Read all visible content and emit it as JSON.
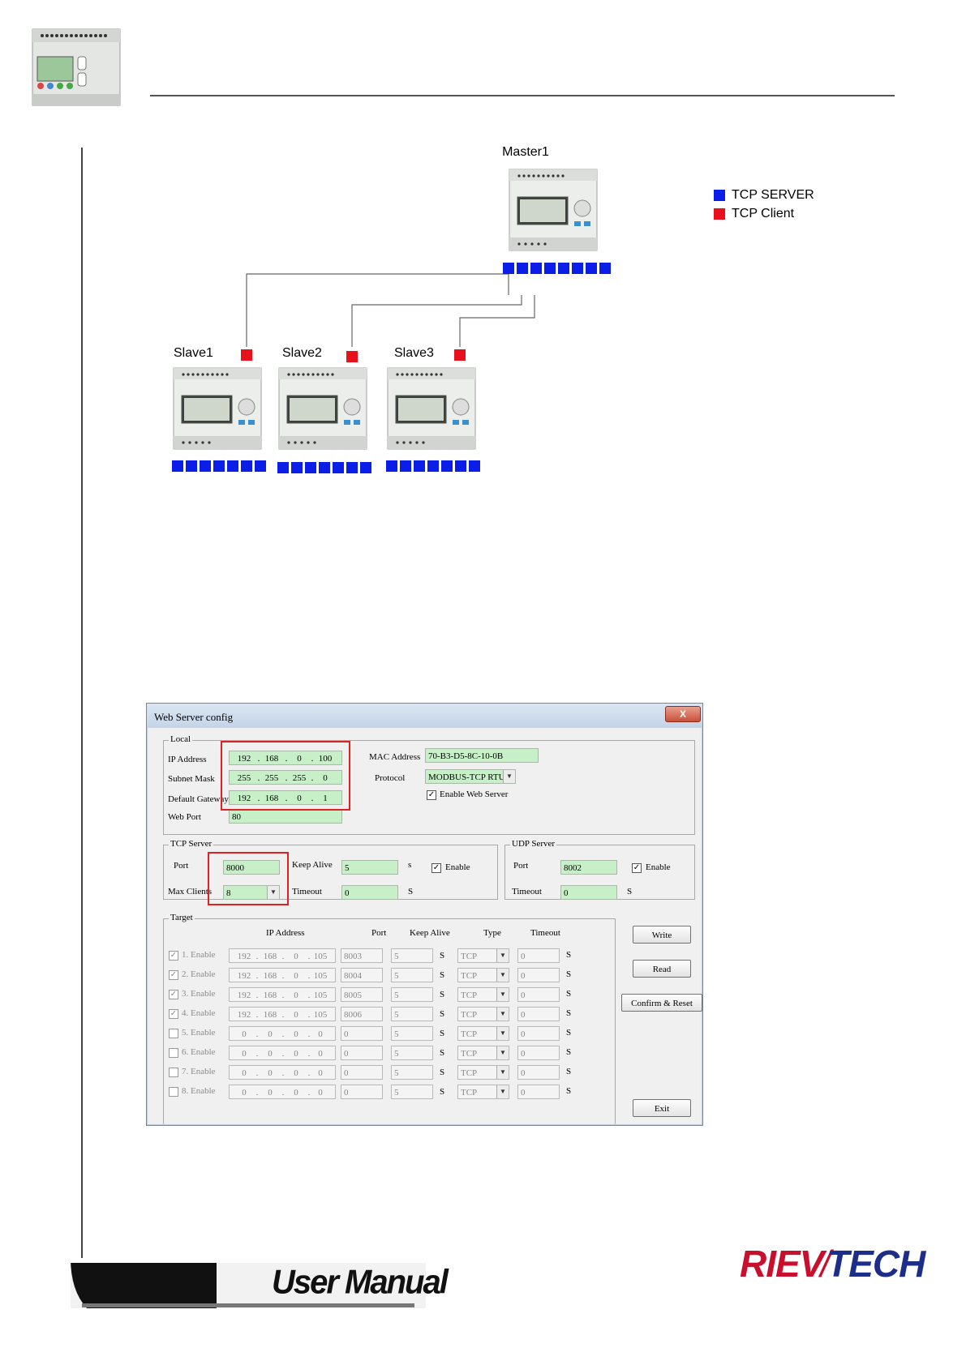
{
  "figure": {
    "master_label": "Master1",
    "slave_labels": [
      "Slave1",
      "Slave2",
      "Slave3"
    ],
    "legend": [
      {
        "label": "TCP SERVER",
        "color": "#0a1ee8"
      },
      {
        "label": "TCP Client",
        "color": "#e8101a"
      }
    ]
  },
  "dialog": {
    "title": "Web Server config",
    "close_label": "X",
    "local": {
      "group_label": "Local",
      "ip_label": "IP Address",
      "ip": [
        "192",
        "168",
        "0",
        "100"
      ],
      "subnet_label": "Subnet Mask",
      "subnet": [
        "255",
        "255",
        "255",
        "0"
      ],
      "gateway_label": "Default Gateway",
      "gateway": [
        "192",
        "168",
        "0",
        "1"
      ],
      "webport_label": "Web Port",
      "webport": "80",
      "mac_label": "MAC Address",
      "mac": "70-B3-D5-8C-10-0B",
      "protocol_label": "Protocol",
      "protocol": "MODBUS-TCP RTU",
      "enable_web_label": "Enable Web Server"
    },
    "tcp_server": {
      "group_label": "TCP Server",
      "port_label": "Port",
      "port": "8000",
      "keepalive_label": "Keep Alive",
      "keepalive": "5",
      "keepalive_unit": "s",
      "enable_label": "Enable",
      "maxclients_label": "Max Clients",
      "maxclients": "8",
      "timeout_label": "Timeout",
      "timeout": "0",
      "timeout_unit": "S"
    },
    "udp_server": {
      "group_label": "UDP Server",
      "port_label": "Port",
      "port": "8002",
      "enable_label": "Enable",
      "timeout_label": "Timeout",
      "timeout": "0",
      "timeout_unit": "S"
    },
    "target": {
      "group_label": "Target",
      "headers": {
        "ip": "IP Address",
        "port": "Port",
        "keepalive": "Keep Alive",
        "type": "Type",
        "timeout": "Timeout"
      },
      "unit": "S",
      "rows": [
        {
          "label": "1. Enable",
          "checked": true,
          "ip": [
            "192",
            "168",
            "0",
            "105"
          ],
          "port": "8003",
          "keepalive": "5",
          "type": "TCP",
          "timeout": "0"
        },
        {
          "label": "2. Enable",
          "checked": true,
          "ip": [
            "192",
            "168",
            "0",
            "105"
          ],
          "port": "8004",
          "keepalive": "5",
          "type": "TCP",
          "timeout": "0"
        },
        {
          "label": "3. Enable",
          "checked": true,
          "ip": [
            "192",
            "168",
            "0",
            "105"
          ],
          "port": "8005",
          "keepalive": "5",
          "type": "TCP",
          "timeout": "0"
        },
        {
          "label": "4. Enable",
          "checked": true,
          "ip": [
            "192",
            "168",
            "0",
            "105"
          ],
          "port": "8006",
          "keepalive": "5",
          "type": "TCP",
          "timeout": "0"
        },
        {
          "label": "5. Enable",
          "checked": false,
          "ip": [
            "0",
            "0",
            "0",
            "0"
          ],
          "port": "0",
          "keepalive": "5",
          "type": "TCP",
          "timeout": "0"
        },
        {
          "label": "6. Enable",
          "checked": false,
          "ip": [
            "0",
            "0",
            "0",
            "0"
          ],
          "port": "0",
          "keepalive": "5",
          "type": "TCP",
          "timeout": "0"
        },
        {
          "label": "7. Enable",
          "checked": false,
          "ip": [
            "0",
            "0",
            "0",
            "0"
          ],
          "port": "0",
          "keepalive": "5",
          "type": "TCP",
          "timeout": "0"
        },
        {
          "label": "8. Enable",
          "checked": false,
          "ip": [
            "0",
            "0",
            "0",
            "0"
          ],
          "port": "0",
          "keepalive": "5",
          "type": "TCP",
          "timeout": "0"
        }
      ]
    },
    "buttons": {
      "write": "Write",
      "read": "Read",
      "confirm": "Confirm & Reset",
      "exit": "Exit"
    }
  },
  "footer": {
    "manual_label": "User Manual",
    "brand_left": "RIEV",
    "brand_right": "TECH",
    "brand_color": "#c8102e",
    "brand_color2": "#1d2d8a"
  }
}
